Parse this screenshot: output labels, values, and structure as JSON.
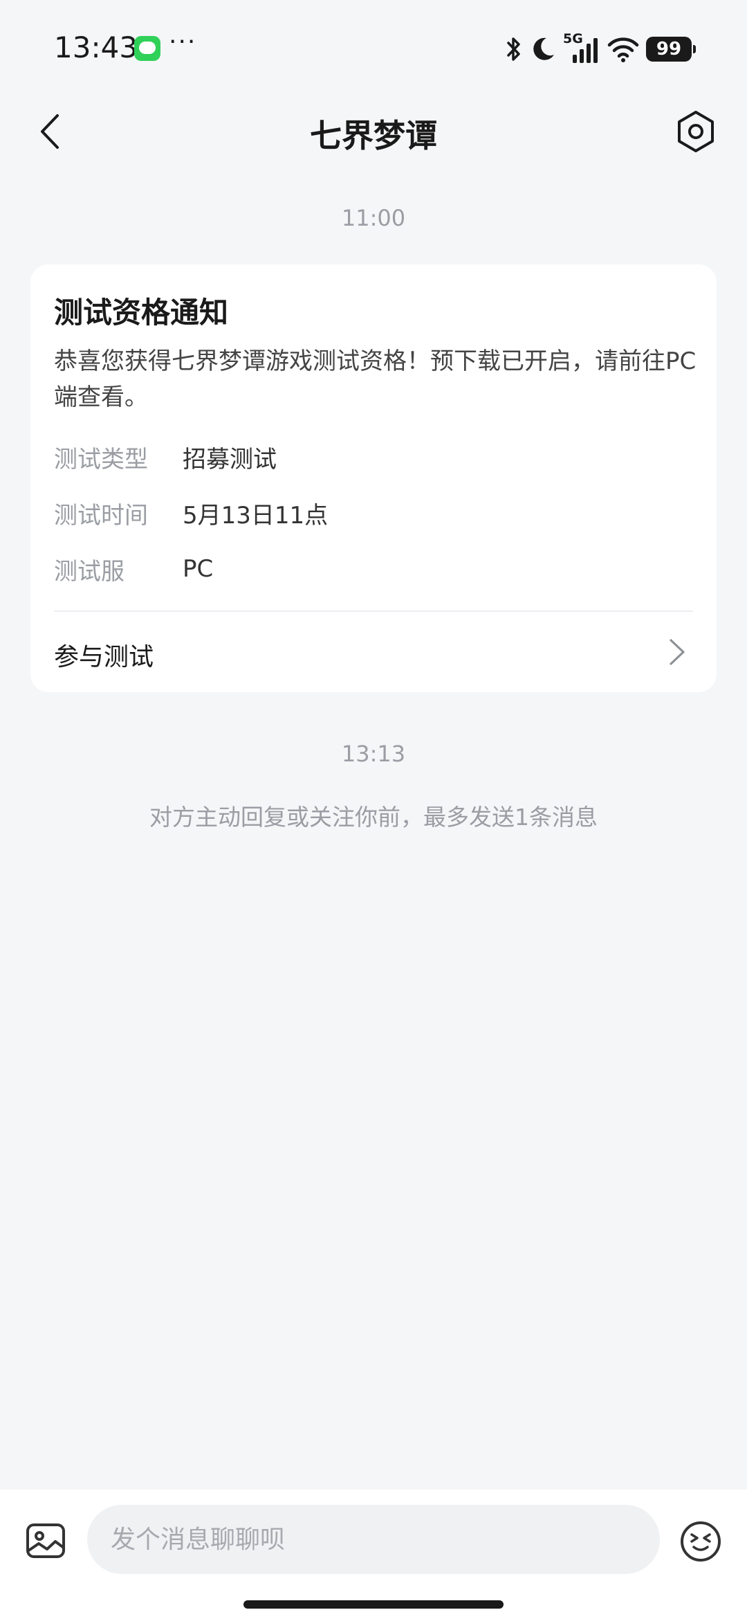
{
  "status_bar": {
    "time": "13:43",
    "more": "···",
    "network": "5G",
    "battery": "99"
  },
  "header": {
    "title": "七界梦谭"
  },
  "messages": {
    "timestamp_1": "11:00",
    "timestamp_2": "13:13"
  },
  "card": {
    "title": "测试资格通知",
    "description": "恭喜您获得七界梦谭游戏测试资格！预下载已开启，请前往PC端查看。",
    "rows": [
      {
        "label": "测试类型",
        "value": "招募测试"
      },
      {
        "label": "测试时间",
        "value": "5月13日11点"
      },
      {
        "label": "测试服",
        "value": "PC"
      }
    ],
    "action_label": "参与测试"
  },
  "notice": "对方主动回复或关注你前，最多发送1条消息",
  "input": {
    "placeholder": "发个消息聊聊呗"
  }
}
